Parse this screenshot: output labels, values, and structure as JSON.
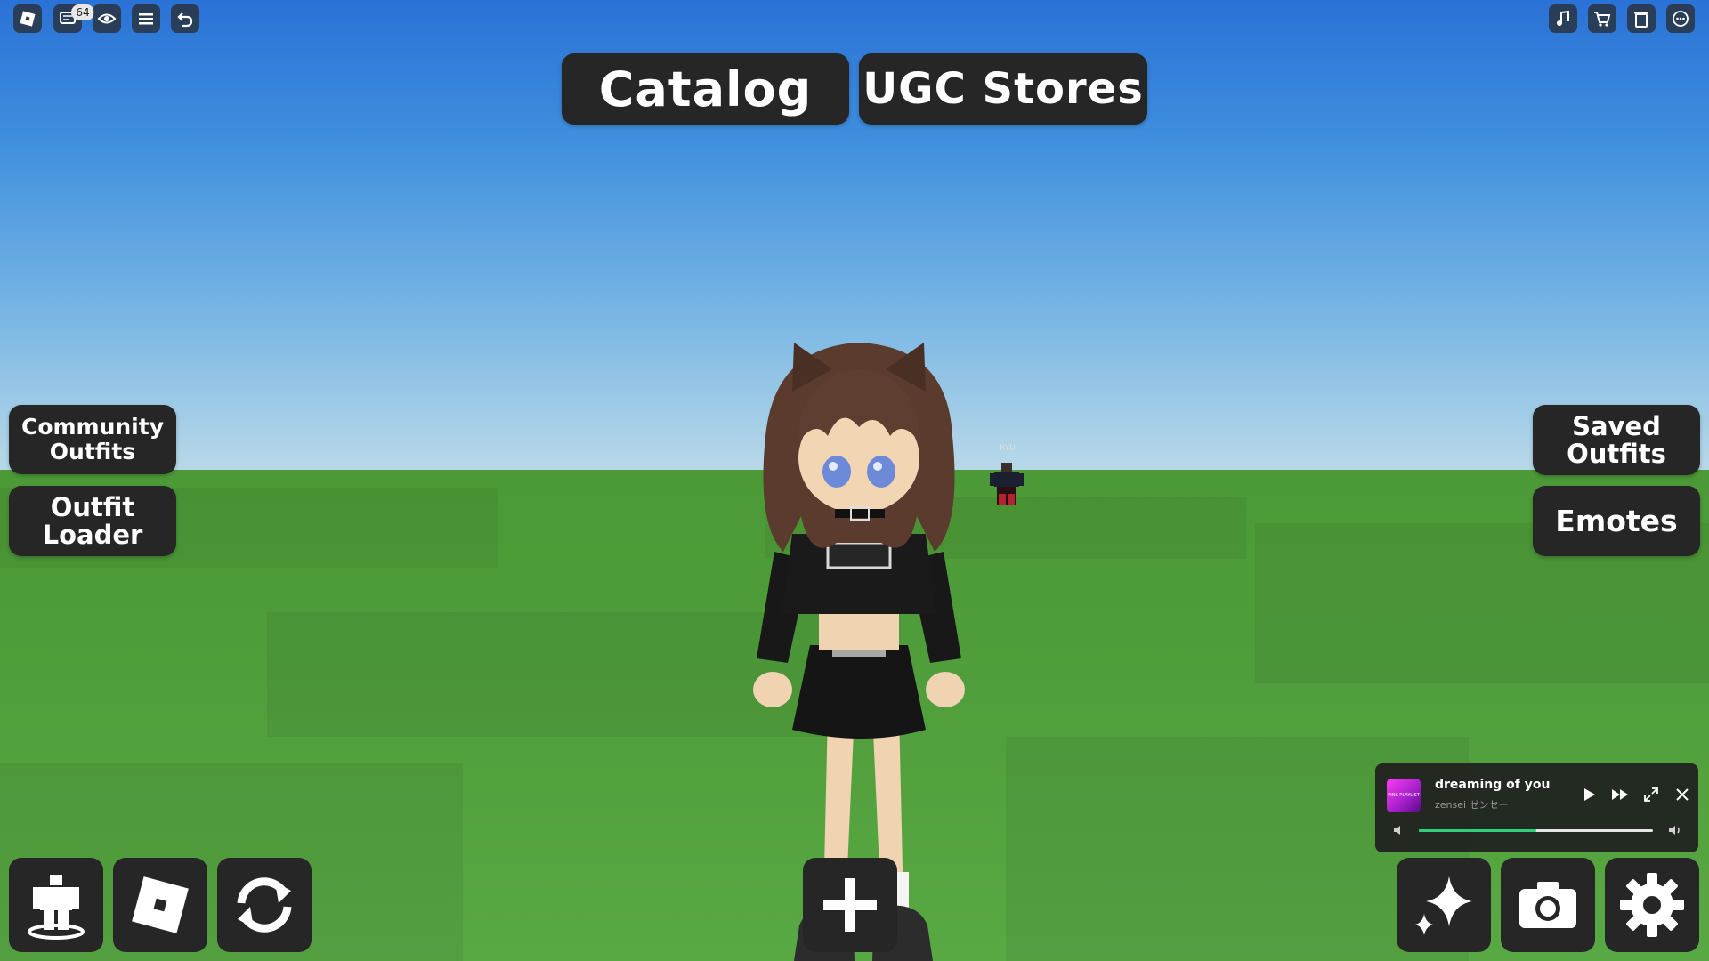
{
  "topbar": {
    "notification_count": "64",
    "icons": [
      "roblox-menu-icon",
      "chat-icon",
      "eye-icon",
      "hamburger-menu-icon",
      "undo-icon"
    ],
    "right_icons": [
      "music-note-icon",
      "cart-icon",
      "trash-icon",
      "more-icon"
    ]
  },
  "tabs": {
    "catalog": "Catalog",
    "ugc_stores": "UGC Stores"
  },
  "left_panel": {
    "community_outfits": "Community\nOutfits",
    "outfit_loader": "Outfit\nLoader"
  },
  "right_panel": {
    "saved_outfits": "Saved\nOutfits",
    "emotes": "Emotes"
  },
  "npc": {
    "name": "RYU"
  },
  "music_player": {
    "title": "dreaming of you",
    "artist": "zensei ゼンセー",
    "cover_text": "PINK PLAYLIST",
    "progress": 0.5
  },
  "bottom_bar": {
    "left_icons": [
      "avatar-rotate-icon",
      "roblox-logo-icon",
      "refresh-icon"
    ],
    "center_icon": "add-icon",
    "right_icons": [
      "sparkles-icon",
      "camera-icon",
      "settings-gear-icon"
    ]
  },
  "colors": {
    "panel_bg": "#262626",
    "progress_fill": "#2ed07a",
    "sky_top": "#2a72d6",
    "ground": "#4f9d3a"
  }
}
